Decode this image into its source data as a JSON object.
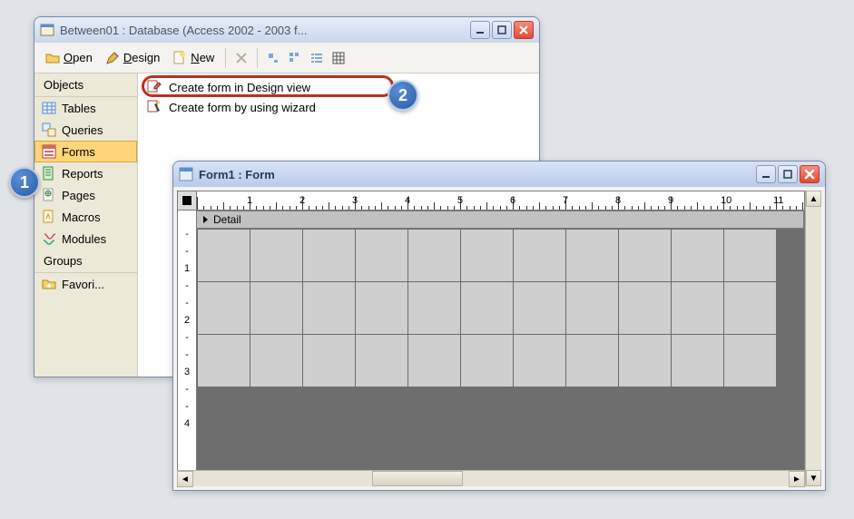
{
  "db_window": {
    "title": "Between01 : Database (Access 2002 - 2003 f...",
    "toolbar": {
      "open": "Open",
      "design": "Design",
      "new": "New"
    },
    "sidebar": {
      "objects_head": "Objects",
      "groups_head": "Groups",
      "items": [
        {
          "label": "Tables"
        },
        {
          "label": "Queries"
        },
        {
          "label": "Forms"
        },
        {
          "label": "Reports"
        },
        {
          "label": "Pages"
        },
        {
          "label": "Macros"
        },
        {
          "label": "Modules"
        }
      ],
      "favorites": "Favori..."
    },
    "list": {
      "design": "Create form in Design view",
      "wizard": "Create form by using wizard"
    }
  },
  "form_window": {
    "title": "Form1 : Form",
    "section": "Detail",
    "ruler_inches": [
      "1",
      "2",
      "3",
      "4",
      "5",
      "6",
      "7",
      "8",
      "9",
      "10",
      "11"
    ],
    "ruler_v": [
      "-",
      "-",
      "1",
      "-",
      "-",
      "2",
      "-",
      "-",
      "3",
      "-",
      "-",
      "4"
    ]
  },
  "callouts": {
    "one": "1",
    "two": "2"
  }
}
